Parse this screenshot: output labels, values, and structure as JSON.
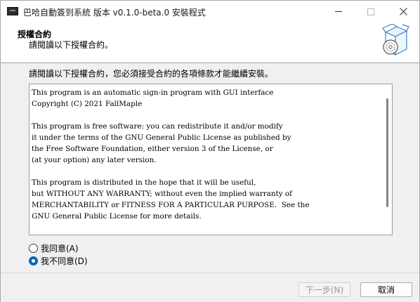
{
  "window": {
    "title": "巴哈自動簽到系統 版本 v0.1.0-beta.0 安裝程式"
  },
  "header": {
    "title": "授權合約",
    "subtitle": "請閱讀以下授權合約。"
  },
  "main": {
    "instruction": "請閱讀以下授權合約，您必須接受合約的各項條款才能繼續安裝。",
    "license_text": "This program is an automatic sign-in program with GUI interface\nCopyright (C) 2021 FallMaple\n\nThis program is free software: you can redistribute it and/or modify\nit under the terms of the GNU General Public License as published by\nthe Free Software Foundation, either version 3 of the License, or\n(at your option) any later version.\n\nThis program is distributed in the hope that it will be useful,\nbut WITHOUT ANY WARRANTY; without even the implied warranty of\nMERCHANTABILITY or FITNESS FOR A PARTICULAR PURPOSE.  See the\nGNU General Public License for more details.",
    "options": [
      {
        "label": "我同意(A)",
        "selected": false
      },
      {
        "label": "我不同意(D)",
        "selected": true
      }
    ]
  },
  "footer": {
    "next_label": "下一步(N)",
    "next_enabled": false,
    "cancel_label": "取消"
  },
  "colors": {
    "accent": "#0a64c0",
    "disabled_text": "#9a9a9a"
  },
  "icons": {
    "app": "setup-app-icon",
    "header": "install-box-disc-icon"
  }
}
